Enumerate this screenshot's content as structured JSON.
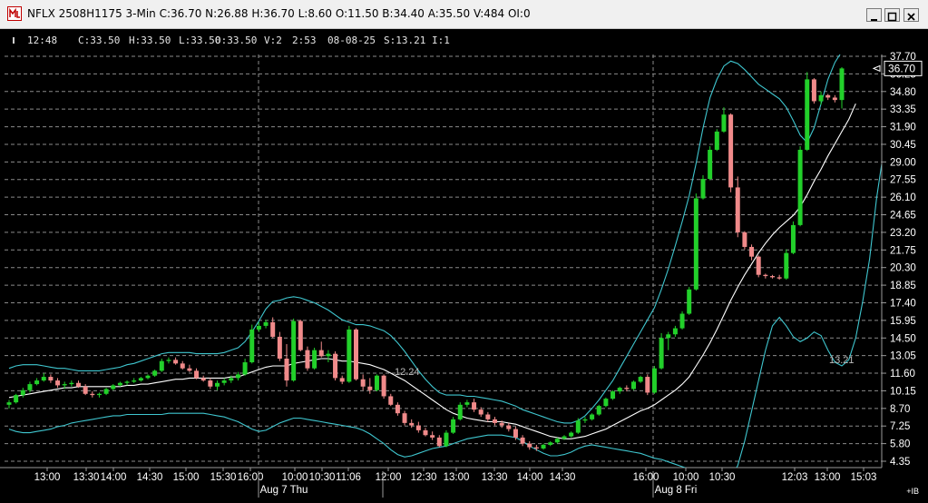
{
  "window": {
    "title": "NFLX 2508H1175 3-Min C:36.70 N:26.88 H:36.70 L:8.60 O:11.50 B:34.40 A:35.50 V:484 OI:0"
  },
  "info_bar": [
    {
      "key": "time",
      "text": "12:48"
    },
    {
      "key": "close",
      "text": "C:33.50"
    },
    {
      "key": "high",
      "text": "H:33.50"
    },
    {
      "key": "low",
      "text": "L:33.50"
    },
    {
      "key": "open",
      "text": "O:33.50"
    },
    {
      "key": "volume",
      "text": "V:2"
    },
    {
      "key": "time2",
      "text": "2:53"
    },
    {
      "key": "date",
      "text": "08-08-25"
    },
    {
      "key": "study",
      "text": "S:13.21"
    },
    {
      "key": "interval",
      "text": "I:1"
    }
  ],
  "chart_data": {
    "type": "candlestick",
    "symbol": "NFLX 2508H1175",
    "interval": "3-Min",
    "y_range": [
      4.0,
      38.2
    ],
    "y_ticks": [
      "37.70",
      "36.25",
      "34.80",
      "33.35",
      "31.90",
      "30.45",
      "29.00",
      "27.55",
      "26.10",
      "24.65",
      "23.20",
      "21.75",
      "20.30",
      "18.85",
      "17.40",
      "15.95",
      "14.50",
      "13.05",
      "11.60",
      "10.15",
      "8.70",
      "7.25",
      "5.80",
      "4.35"
    ],
    "last_price": "36.70",
    "annotations": [
      {
        "text": "12.24"
      },
      {
        "text": "13.21"
      }
    ],
    "x_ticks": [
      "13:00",
      "13:30",
      "14:00",
      "14:30",
      "15:00",
      "15:30",
      "16:00",
      "10:00",
      "10:30",
      "11:06",
      "12:00",
      "12:30",
      "13:00",
      "13:30",
      "14:00",
      "14:30",
      "16:00",
      "10:00",
      "10:30",
      "12:03",
      "13:00",
      "15:03"
    ],
    "day_labels": [
      "Aug 7 Thu",
      "Aug 8 Fri"
    ],
    "colors": {
      "up": "#22d02a",
      "down": "#f08a8a",
      "bands": "#3fc6cf",
      "ma": "#ffffff",
      "grid": "#8a8a8a",
      "background": "#000000"
    },
    "bars": [
      [
        9.0,
        9.4,
        8.7,
        9.2
      ],
      [
        9.2,
        9.9,
        9.1,
        9.8
      ],
      [
        9.8,
        10.4,
        9.6,
        10.2
      ],
      [
        10.2,
        10.9,
        10.0,
        10.7
      ],
      [
        10.7,
        11.2,
        10.6,
        11.0
      ],
      [
        11.0,
        11.6,
        10.9,
        11.3
      ],
      [
        11.3,
        11.5,
        10.8,
        11.0
      ],
      [
        11.0,
        11.2,
        10.4,
        10.6
      ],
      [
        10.6,
        10.9,
        10.3,
        10.7
      ],
      [
        10.7,
        11.0,
        10.5,
        10.8
      ],
      [
        10.8,
        11.0,
        10.4,
        10.5
      ],
      [
        10.5,
        10.7,
        9.8,
        9.9
      ],
      [
        9.9,
        10.1,
        9.6,
        9.8
      ],
      [
        9.8,
        10.0,
        9.6,
        9.9
      ],
      [
        9.9,
        10.4,
        9.8,
        10.3
      ],
      [
        10.3,
        10.7,
        10.2,
        10.6
      ],
      [
        10.6,
        10.9,
        10.5,
        10.8
      ],
      [
        10.8,
        11.0,
        10.6,
        10.9
      ],
      [
        10.9,
        11.2,
        10.8,
        11.0
      ],
      [
        11.0,
        11.3,
        10.9,
        11.2
      ],
      [
        11.2,
        11.5,
        11.1,
        11.4
      ],
      [
        11.4,
        11.9,
        11.3,
        11.8
      ],
      [
        11.8,
        12.8,
        11.7,
        12.6
      ],
      [
        12.6,
        12.9,
        12.4,
        12.7
      ],
      [
        12.7,
        12.9,
        12.3,
        12.4
      ],
      [
        12.4,
        12.6,
        11.9,
        12.0
      ],
      [
        12.0,
        12.3,
        11.7,
        11.8
      ],
      [
        11.8,
        12.0,
        11.1,
        11.2
      ],
      [
        11.2,
        11.4,
        10.9,
        11.0
      ],
      [
        11.0,
        11.2,
        10.3,
        10.5
      ],
      [
        10.5,
        11.0,
        10.2,
        10.8
      ],
      [
        10.8,
        11.2,
        10.6,
        11.0
      ],
      [
        11.0,
        11.4,
        10.8,
        11.2
      ],
      [
        11.2,
        11.7,
        11.0,
        11.5
      ],
      [
        11.5,
        12.8,
        11.4,
        12.5
      ],
      [
        12.5,
        15.6,
        12.4,
        15.2
      ],
      [
        15.2,
        15.8,
        15.0,
        15.5
      ],
      [
        15.5,
        16.0,
        15.3,
        15.8
      ],
      [
        15.8,
        16.2,
        14.5,
        14.6
      ],
      [
        14.6,
        15.0,
        12.6,
        12.8
      ],
      [
        12.8,
        14.0,
        10.5,
        11.0
      ],
      [
        11.0,
        16.1,
        10.9,
        15.9
      ],
      [
        15.9,
        16.0,
        13.4,
        13.5
      ],
      [
        13.5,
        13.8,
        11.8,
        12.0
      ],
      [
        12.0,
        13.7,
        11.9,
        13.5
      ],
      [
        13.5,
        14.2,
        12.9,
        13.0
      ],
      [
        13.0,
        13.5,
        12.5,
        13.2
      ],
      [
        13.2,
        13.4,
        11.0,
        11.2
      ],
      [
        11.2,
        11.4,
        10.7,
        10.9
      ],
      [
        10.9,
        15.5,
        10.8,
        15.2
      ],
      [
        15.2,
        15.3,
        11.0,
        11.1
      ],
      [
        11.1,
        11.5,
        10.2,
        10.5
      ],
      [
        10.5,
        11.2,
        9.9,
        10.2
      ],
      [
        10.2,
        11.5,
        10.1,
        11.4
      ],
      [
        11.4,
        11.5,
        9.5,
        9.7
      ],
      [
        9.7,
        9.9,
        8.9,
        9.0
      ],
      [
        9.0,
        9.2,
        8.1,
        8.3
      ],
      [
        8.3,
        8.5,
        7.3,
        7.5
      ],
      [
        7.5,
        7.8,
        7.1,
        7.3
      ],
      [
        7.3,
        7.6,
        6.7,
        6.9
      ],
      [
        6.9,
        7.1,
        6.4,
        6.5
      ],
      [
        6.5,
        6.8,
        6.1,
        6.3
      ],
      [
        6.3,
        6.5,
        5.5,
        5.6
      ],
      [
        5.6,
        6.9,
        5.5,
        6.7
      ],
      [
        6.7,
        8.0,
        6.6,
        7.8
      ],
      [
        7.8,
        9.2,
        7.7,
        9.0
      ],
      [
        9.0,
        9.4,
        8.8,
        9.2
      ],
      [
        9.2,
        9.5,
        8.4,
        8.6
      ],
      [
        8.6,
        8.8,
        8.0,
        8.2
      ],
      [
        8.2,
        8.4,
        7.6,
        7.8
      ],
      [
        7.8,
        8.0,
        7.3,
        7.5
      ],
      [
        7.5,
        7.7,
        7.1,
        7.3
      ],
      [
        7.3,
        7.5,
        6.8,
        7.0
      ],
      [
        7.0,
        7.2,
        6.1,
        6.3
      ],
      [
        6.3,
        6.5,
        5.6,
        5.8
      ],
      [
        5.8,
        6.0,
        5.3,
        5.5
      ],
      [
        5.5,
        5.7,
        5.2,
        5.4
      ],
      [
        5.4,
        5.8,
        5.3,
        5.7
      ],
      [
        5.7,
        6.0,
        5.6,
        5.9
      ],
      [
        5.9,
        6.3,
        5.8,
        6.2
      ],
      [
        6.2,
        6.5,
        6.1,
        6.4
      ],
      [
        6.4,
        6.8,
        6.3,
        6.7
      ],
      [
        6.7,
        7.9,
        6.6,
        7.7
      ],
      [
        7.7,
        8.0,
        7.5,
        7.8
      ],
      [
        7.8,
        8.3,
        7.7,
        8.2
      ],
      [
        8.2,
        9.0,
        8.1,
        8.9
      ],
      [
        8.9,
        9.6,
        8.8,
        9.5
      ],
      [
        9.5,
        10.2,
        9.4,
        10.1
      ],
      [
        10.1,
        10.5,
        9.9,
        10.4
      ],
      [
        10.4,
        10.6,
        10.1,
        10.3
      ],
      [
        10.3,
        11.0,
        10.2,
        10.9
      ],
      [
        10.9,
        11.4,
        10.8,
        11.3
      ],
      [
        11.3,
        11.5,
        9.8,
        10.0
      ],
      [
        10.0,
        12.2,
        9.9,
        12.0
      ],
      [
        12.0,
        14.9,
        11.9,
        14.5
      ],
      [
        14.5,
        15.0,
        13.5,
        14.8
      ],
      [
        14.8,
        15.5,
        14.6,
        15.3
      ],
      [
        15.3,
        16.7,
        15.2,
        16.5
      ],
      [
        16.5,
        18.7,
        16.4,
        18.5
      ],
      [
        18.5,
        26.4,
        18.4,
        26.0
      ],
      [
        26.0,
        27.9,
        25.9,
        27.6
      ],
      [
        27.6,
        30.3,
        27.5,
        30.0
      ],
      [
        30.0,
        31.7,
        29.9,
        31.5
      ],
      [
        31.5,
        33.5,
        31.4,
        32.9
      ],
      [
        32.9,
        33.0,
        26.5,
        26.9
      ],
      [
        26.9,
        27.8,
        22.8,
        23.2
      ],
      [
        23.2,
        23.3,
        21.8,
        22.0
      ],
      [
        22.0,
        22.2,
        20.9,
        21.2
      ],
      [
        21.2,
        21.3,
        19.5,
        19.7
      ],
      [
        19.7,
        19.8,
        19.4,
        19.6
      ],
      [
        19.6,
        19.7,
        19.4,
        19.5
      ],
      [
        19.5,
        19.7,
        19.3,
        19.4
      ],
      [
        19.4,
        21.8,
        19.3,
        21.5
      ],
      [
        21.5,
        24.1,
        21.4,
        23.8
      ],
      [
        23.8,
        30.3,
        23.7,
        30.0
      ],
      [
        30.0,
        36.4,
        29.9,
        35.8
      ],
      [
        35.8,
        35.9,
        33.8,
        34.0
      ],
      [
        34.0,
        34.8,
        33.7,
        34.5
      ],
      [
        34.5,
        34.6,
        34.1,
        34.3
      ],
      [
        34.3,
        34.5,
        33.9,
        34.1
      ],
      [
        34.1,
        36.8,
        33.4,
        36.7
      ]
    ],
    "indicators": {
      "moving_average": [
        9.6,
        9.7,
        9.8,
        9.9,
        10.0,
        10.1,
        10.2,
        10.3,
        10.4,
        10.4,
        10.5,
        10.5,
        10.5,
        10.5,
        10.5,
        10.5,
        10.5,
        10.6,
        10.6,
        10.7,
        10.7,
        10.8,
        10.9,
        11.0,
        11.1,
        11.1,
        11.2,
        11.2,
        11.2,
        11.2,
        11.2,
        11.2,
        11.3,
        11.3,
        11.5,
        11.7,
        11.9,
        12.1,
        12.2,
        12.2,
        12.2,
        12.4,
        12.5,
        12.6,
        12.7,
        12.8,
        12.8,
        12.7,
        12.6,
        12.6,
        12.5,
        12.4,
        12.3,
        12.1,
        11.9,
        11.6,
        11.3,
        11.0,
        10.6,
        10.2,
        9.8,
        9.4,
        9.0,
        8.6,
        8.3,
        8.1,
        7.9,
        7.8,
        7.7,
        7.6,
        7.6,
        7.6,
        7.5,
        7.4,
        7.2,
        7.0,
        6.8,
        6.6,
        6.4,
        6.3,
        6.2,
        6.2,
        6.3,
        6.4,
        6.6,
        6.8,
        7.0,
        7.3,
        7.6,
        7.9,
        8.2,
        8.5,
        8.7,
        9.0,
        9.4,
        9.8,
        10.2,
        10.7,
        11.3,
        12.2,
        13.1,
        14.1,
        15.2,
        16.4,
        17.6,
        18.7,
        19.7,
        20.6,
        21.5,
        22.3,
        23.0,
        23.6,
        24.1,
        24.6,
        25.3,
        26.3,
        27.4,
        28.4,
        29.5,
        30.5,
        31.5,
        32.5,
        33.8
      ],
      "band_upper": [
        12.0,
        12.2,
        12.3,
        12.3,
        12.3,
        12.2,
        12.1,
        12.0,
        12.0,
        11.9,
        11.8,
        11.8,
        11.8,
        11.8,
        11.9,
        12.0,
        12.1,
        12.3,
        12.4,
        12.6,
        12.8,
        13.0,
        13.2,
        13.3,
        13.3,
        13.3,
        13.3,
        13.2,
        13.2,
        13.2,
        13.2,
        13.3,
        13.5,
        13.7,
        14.2,
        15.0,
        15.9,
        16.9,
        17.5,
        17.6,
        17.8,
        17.9,
        17.8,
        17.6,
        17.4,
        17.1,
        16.8,
        16.4,
        16.0,
        15.8,
        15.6,
        15.6,
        15.5,
        15.3,
        15.1,
        14.7,
        14.1,
        13.4,
        12.6,
        11.8,
        11.1,
        10.5,
        10.0,
        9.8,
        9.8,
        9.8,
        9.7,
        9.7,
        9.6,
        9.5,
        9.4,
        9.3,
        9.1,
        8.9,
        8.6,
        8.4,
        8.2,
        8.0,
        7.8,
        7.6,
        7.5,
        7.5,
        7.7,
        8.1,
        8.7,
        9.4,
        10.2,
        11.0,
        12.0,
        13.0,
        14.0,
        15.0,
        16.0,
        17.0,
        18.5,
        20.2,
        22.1,
        24.1,
        26.2,
        28.9,
        31.8,
        34.3,
        35.8,
        36.9,
        37.3,
        37.1,
        36.6,
        36.0,
        35.4,
        35.0,
        34.6,
        34.2,
        33.5,
        32.4,
        31.2,
        30.6,
        31.8,
        33.8,
        35.8,
        37.2,
        38.1,
        38.8,
        39.5,
        40.2
      ],
      "band_lower": [
        7.0,
        6.8,
        6.7,
        6.7,
        6.8,
        6.9,
        7.0,
        7.2,
        7.3,
        7.5,
        7.6,
        7.7,
        7.8,
        7.9,
        8.0,
        8.1,
        8.1,
        8.2,
        8.2,
        8.2,
        8.2,
        8.2,
        8.2,
        8.3,
        8.3,
        8.3,
        8.3,
        8.3,
        8.3,
        8.2,
        8.1,
        8.0,
        7.8,
        7.6,
        7.3,
        7.0,
        6.8,
        6.9,
        7.2,
        7.5,
        7.7,
        7.9,
        7.9,
        7.8,
        7.7,
        7.6,
        7.5,
        7.4,
        7.3,
        7.2,
        7.1,
        6.9,
        6.6,
        6.2,
        5.8,
        5.3,
        4.9,
        4.7,
        4.8,
        5.0,
        5.2,
        5.4,
        5.5,
        5.6,
        5.8,
        6.0,
        6.2,
        6.3,
        6.4,
        6.5,
        6.5,
        6.5,
        6.4,
        6.3,
        6.0,
        5.6,
        5.3,
        5.0,
        4.8,
        4.8,
        4.9,
        5.1,
        5.4,
        5.6,
        5.7,
        5.6,
        5.5,
        5.4,
        5.3,
        5.2,
        5.1,
        5.0,
        4.8,
        4.6,
        4.5,
        4.3,
        4.1,
        3.9,
        3.7,
        3.5,
        3.3,
        3.1,
        3.0,
        3.0,
        3.0,
        4.0,
        6.0,
        8.5,
        11.0,
        13.5,
        15.5,
        16.2,
        15.5,
        14.6,
        14.2,
        14.5,
        15.0,
        14.7,
        13.5,
        12.5,
        12.2,
        12.7,
        14.5,
        17.5,
        21.0,
        26.0,
        29.8
      ]
    }
  }
}
